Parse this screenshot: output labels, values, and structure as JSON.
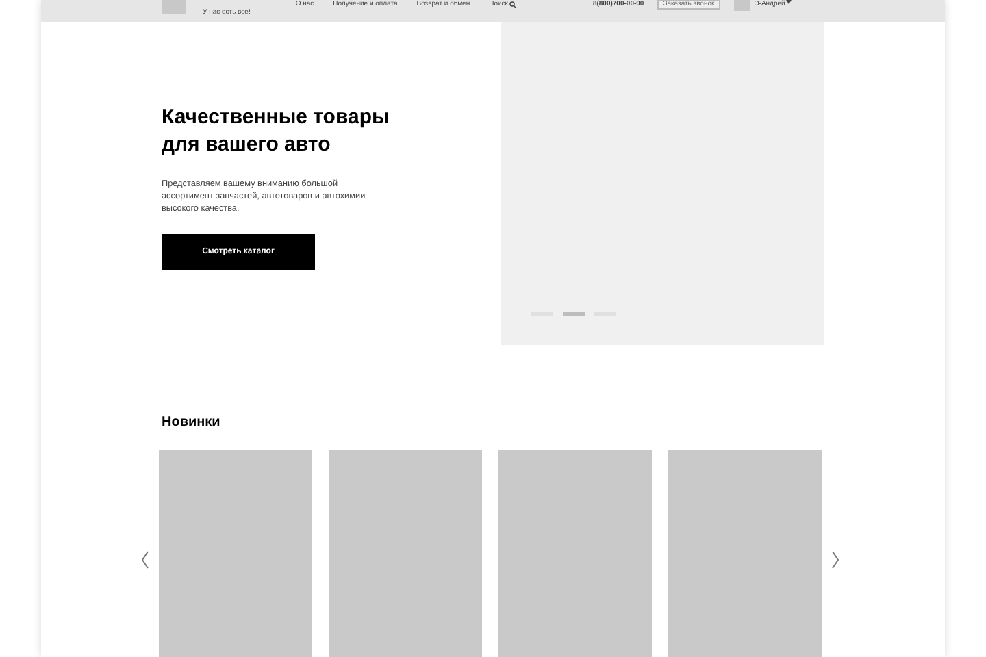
{
  "header": {
    "tagline": "У нас есть все!",
    "nav": [
      "О нас",
      "Получение и оплата",
      "Возврат и обмен",
      "Поиск"
    ],
    "phone": "8(800)700-00-00",
    "callback": "Заказать звонок",
    "account": "Э-Андрей"
  },
  "hero": {
    "title": "Качественные товары для вашего авто",
    "text": "Представляем вашему вниманию большой ассортимент запчастей, автотоваров и автохимии высокого качества.",
    "button": "Смотреть каталог",
    "slides": [
      {
        "selected": false
      },
      {
        "selected": true
      },
      {
        "selected": false
      }
    ]
  },
  "new_items": {
    "title": "Новинки"
  }
}
